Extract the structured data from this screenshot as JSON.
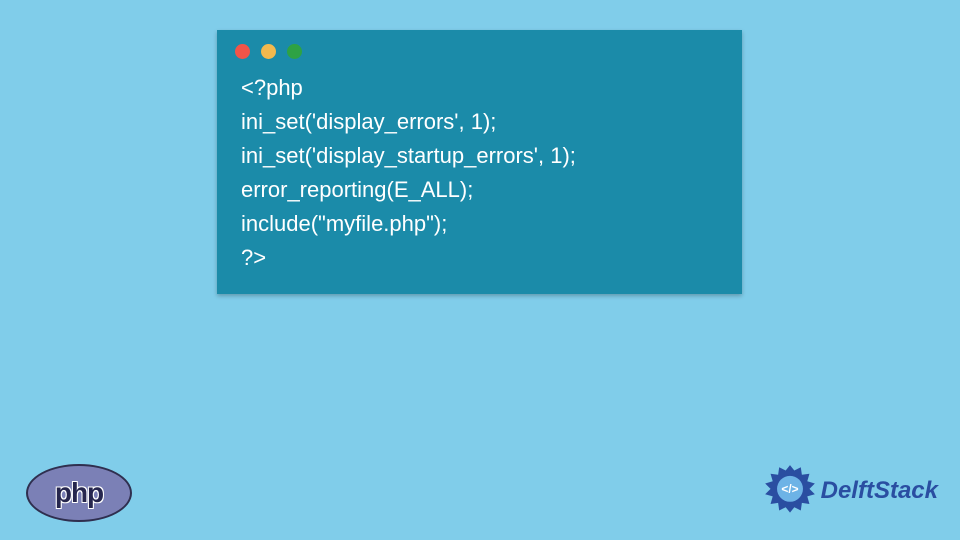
{
  "code": {
    "lines": [
      "<?php",
      "ini_set('display_errors', 1);",
      "ini_set('display_startup_errors', 1);",
      "error_reporting(E_ALL);",
      "include(\"myfile.php\");",
      "?>"
    ]
  },
  "window": {
    "dots": [
      "red",
      "yellow",
      "green"
    ]
  },
  "logos": {
    "php_label": "php",
    "delft_label": "DelftStack"
  },
  "colors": {
    "page_bg": "#80cdea",
    "window_bg": "#1b8ba9",
    "code_fg": "#ffffff",
    "php_fill": "#7b80b6",
    "delft_primary": "#2a4ea1"
  }
}
